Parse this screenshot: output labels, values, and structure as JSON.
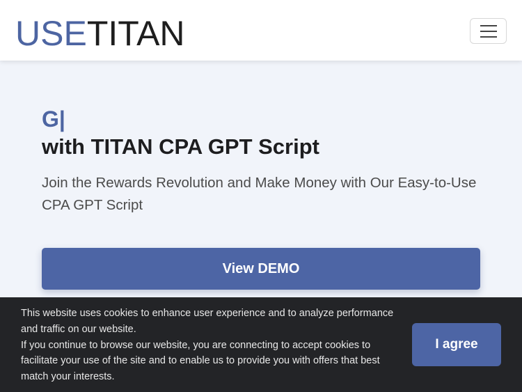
{
  "navbar": {
    "brand_prefix": "USE",
    "brand_suffix": "TITAN",
    "menu_icon": "hamburger-menu-icon"
  },
  "hero": {
    "typed_text": "G|",
    "headline": "with TITAN CPA GPT Script",
    "subtitle": "Join the Rewards Revolution and Make Money with Our Easy-to-Use CPA GPT Script",
    "demo_button": "View DEMO"
  },
  "cookie_banner": {
    "line1": "This website uses cookies to enhance user experience and to analyze performance and traffic on our website.",
    "line2": "If you continue to browse our website, you are connecting to accept cookies to facilitate your use of the site and to enable us to provide you with offers that best match your interests.",
    "agree_button": "I agree"
  },
  "colors": {
    "accent": "#4d65a5",
    "background": "#f1f4fa",
    "cookie_bg": "#232427"
  }
}
